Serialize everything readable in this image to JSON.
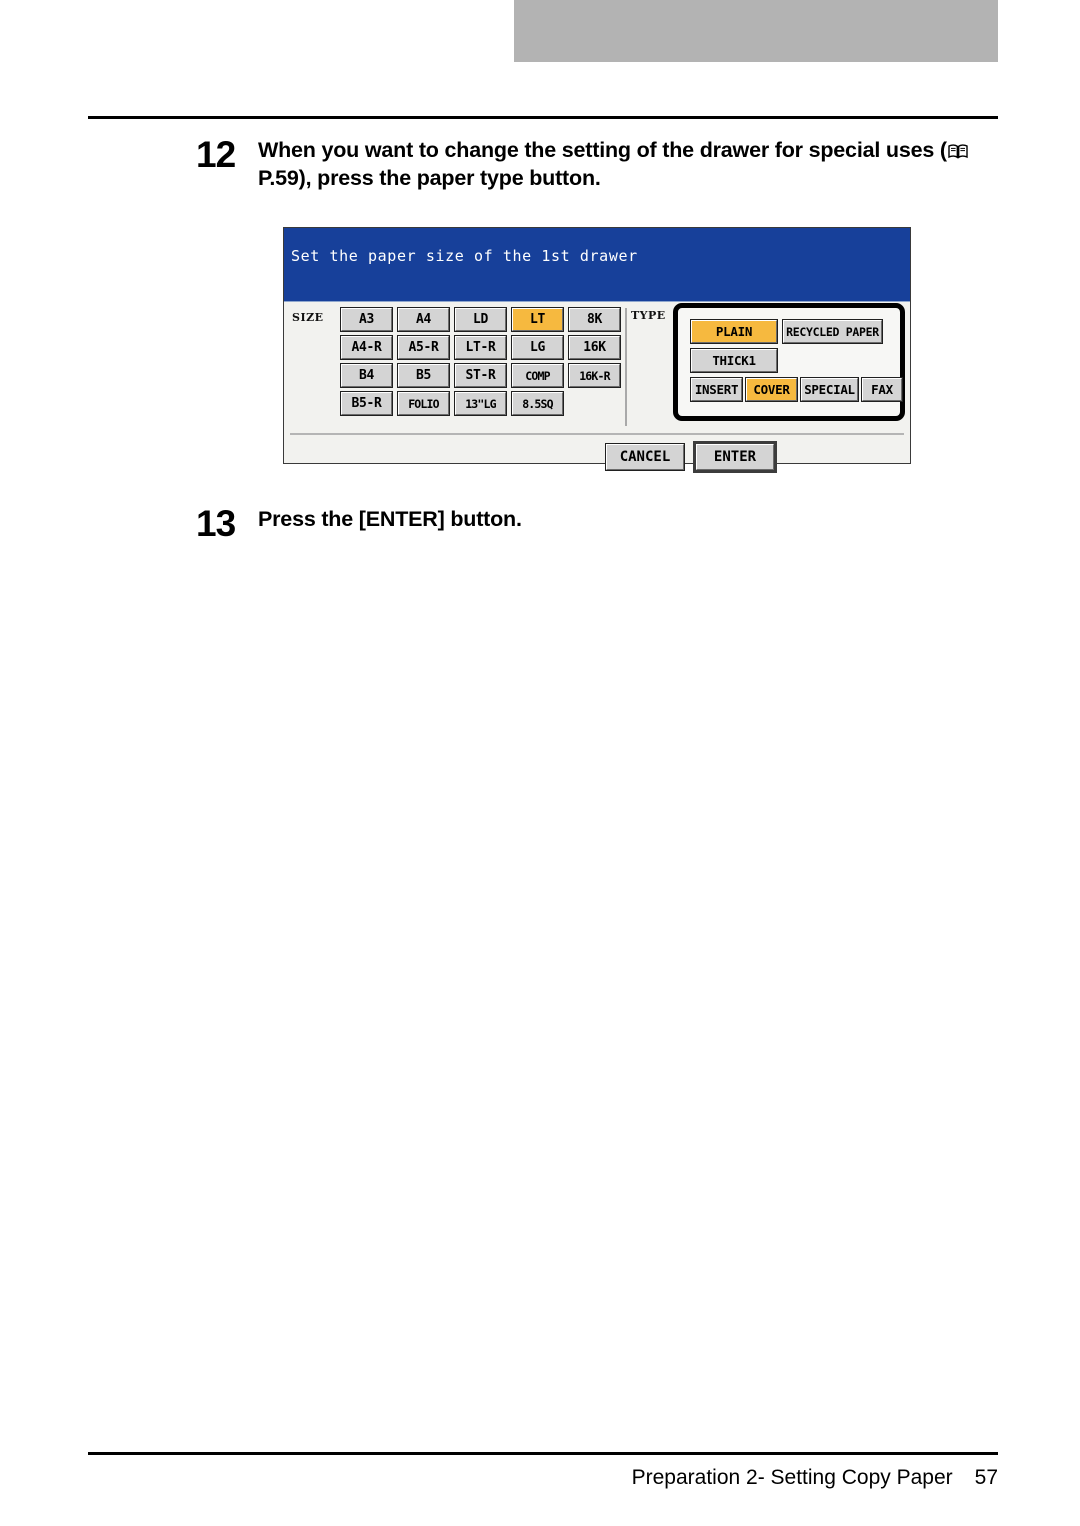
{
  "page": {
    "footer_title": "Preparation 2- Setting Copy Paper",
    "page_number": "57"
  },
  "steps": [
    {
      "number": "12",
      "text_before_icon": "When you want to change the setting of the drawer for special uses (",
      "icon": "book-icon",
      "text_after_icon": " P.59), press the paper type button."
    },
    {
      "number": "13",
      "text": "Press the [ENTER] button."
    }
  ],
  "lcd": {
    "title": "Set the paper size of the 1st drawer",
    "size_label": "SIZE",
    "type_label": "TYPE",
    "size_buttons": [
      {
        "label": "A3",
        "selected": false
      },
      {
        "label": "A4",
        "selected": false
      },
      {
        "label": "LD",
        "selected": false
      },
      {
        "label": "LT",
        "selected": true
      },
      {
        "label": "8K",
        "selected": false
      },
      {
        "label": "A4-R",
        "selected": false
      },
      {
        "label": "A5-R",
        "selected": false
      },
      {
        "label": "LT-R",
        "selected": false
      },
      {
        "label": "LG",
        "selected": false
      },
      {
        "label": "16K",
        "selected": false
      },
      {
        "label": "B4",
        "selected": false
      },
      {
        "label": "B5",
        "selected": false
      },
      {
        "label": "ST-R",
        "selected": false
      },
      {
        "label": "COMP",
        "selected": false
      },
      {
        "label": "16K-R",
        "selected": false
      },
      {
        "label": "B5-R",
        "selected": false
      },
      {
        "label": "FOLIO",
        "selected": false
      },
      {
        "label": "13\"LG",
        "selected": false
      },
      {
        "label": "8.5SQ",
        "selected": false
      }
    ],
    "type_buttons": [
      {
        "label": "PLAIN",
        "selected": true
      },
      {
        "label": "RECYCLED PAPER",
        "selected": false
      },
      {
        "label": "THICK1",
        "selected": false
      },
      {
        "label": "INSERT",
        "selected": false
      },
      {
        "label": "COVER",
        "selected": true
      },
      {
        "label": "SPECIAL",
        "selected": false
      },
      {
        "label": "FAX",
        "selected": false
      }
    ],
    "actions": [
      {
        "label": "CANCEL",
        "emphasis": false
      },
      {
        "label": "ENTER",
        "emphasis": true
      }
    ],
    "colors": {
      "title_bar": "#17409a",
      "selected": "#f6b93f",
      "button_face": "#d4d4d4",
      "panel": "#f2f2ef",
      "callout_border": "#000000"
    }
  }
}
